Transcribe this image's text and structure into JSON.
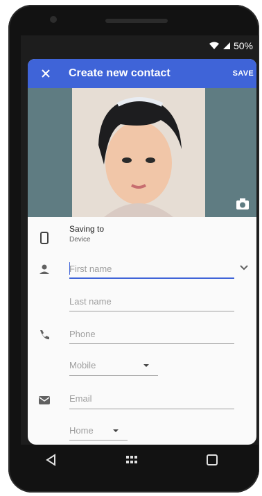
{
  "status": {
    "battery": "50%"
  },
  "app": {
    "title": "Create new contact",
    "save_label": "SAVE"
  },
  "saving": {
    "title": "Saving to",
    "subtitle": "Device"
  },
  "fields": {
    "first_name_placeholder": "First name",
    "last_name_placeholder": "Last name",
    "phone_placeholder": "Phone",
    "phone_type": "Mobile",
    "email_placeholder": "Email",
    "email_type": "Home"
  },
  "colors": {
    "accent": "#3f64d8",
    "photo_bg": "#5f7c82"
  }
}
